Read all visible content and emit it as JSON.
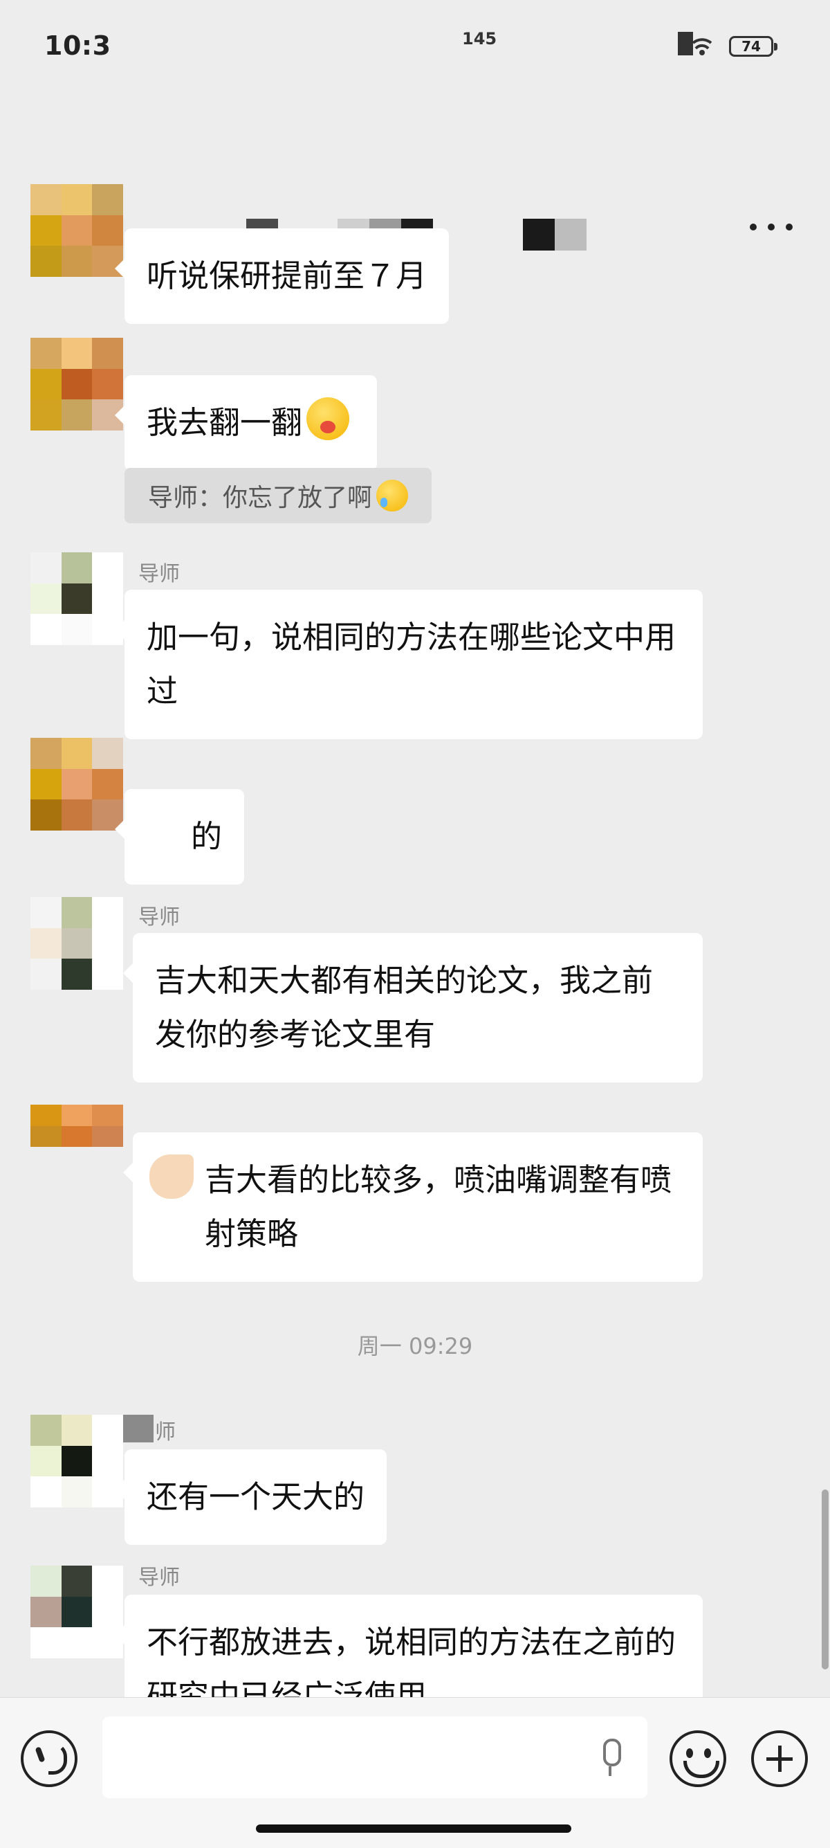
{
  "status_bar": {
    "time": "10:3",
    "network": "145",
    "battery": "74"
  },
  "header": {
    "more_icon": "ellipsis-icon"
  },
  "messages": [
    {
      "sender": "",
      "text": "听说保研提前至７月"
    },
    {
      "sender": "",
      "text": "我去翻一翻",
      "quote": "导师：你忘了放了啊"
    },
    {
      "sender": "导师",
      "text": "加一句，说相同的方法在哪些论文中用过"
    },
    {
      "sender": "",
      "text": "的"
    },
    {
      "sender": "导师",
      "text": "吉大和天大都有相关的论文，我之前发你的参考论文里有"
    },
    {
      "sender": "",
      "text": "吉大看的比较多，喷油嘴调整有喷射策略"
    },
    {
      "sender": "师",
      "text": "还有一个天大的"
    },
    {
      "sender": "导师",
      "text": "不行都放进去，说相同的方法在之前的研究中已经广泛使用"
    }
  ],
  "timestamp": "周一 09:29",
  "input": {
    "placeholder": "",
    "value": ""
  },
  "colors": {
    "background": "#ededed",
    "bubble": "#ffffff",
    "quote_bg": "#dcdcdc"
  }
}
